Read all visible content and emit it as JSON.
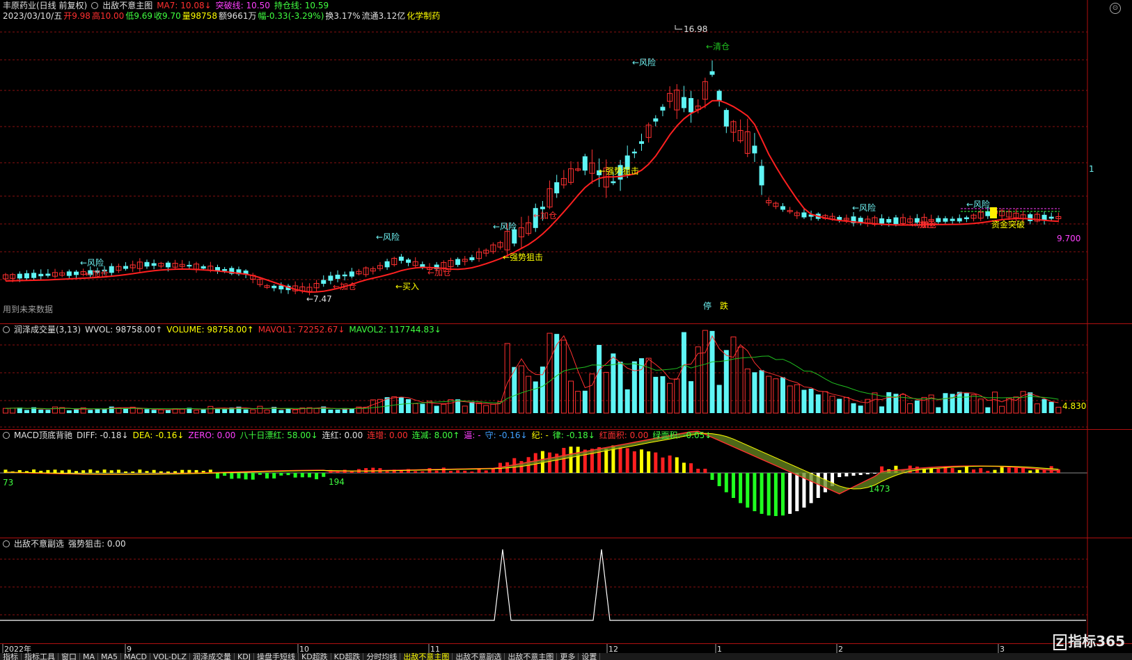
{
  "main": {
    "title_stock": "丰原药业(日线 前复权)",
    "title_indicator": "出敌不意主图",
    "ma7": "MA7: 10.08↓",
    "breakout": "突破线: 10.50",
    "hold": "持仓线: 10.59",
    "date": "2023/03/10/五",
    "open": "开9.98",
    "high": "高10.00",
    "low": "低9.69",
    "close": "收9.70",
    "vol": "量98758",
    "amount": "额9661万",
    "change": "幅-0.33(-3.29%)",
    "turnover": "换3.17%",
    "float": "流通3.12亿",
    "sector": "化学制药",
    "future_note": "用到未来数据",
    "max_label": "16.98",
    "min_label": "7.47",
    "last_label": "9.700",
    "stop_label": "停",
    "drop_label": "跌",
    "signals": [
      {
        "text": "←风险",
        "color": "#6ef0f0"
      },
      {
        "text": "←加仓",
        "color": "#ff3030"
      },
      {
        "text": "←加仓",
        "color": "#ff3030"
      },
      {
        "text": "←风险",
        "color": "#6ef0f0"
      },
      {
        "text": "←买入",
        "color": "#ffff00"
      },
      {
        "text": "←加仓",
        "color": "#ff3030"
      },
      {
        "text": "←风险",
        "color": "#6ef0f0"
      },
      {
        "text": "←强势狙击",
        "color": "#ffff00"
      },
      {
        "text": "←加仓",
        "color": "#ff3030"
      },
      {
        "text": "←强势狙击",
        "color": "#ffff00"
      },
      {
        "text": "←风险",
        "color": "#6ef0f0"
      },
      {
        "text": "←清仓",
        "color": "#20c020"
      },
      {
        "text": "←加仓",
        "color": "#ff3030"
      },
      {
        "text": "←风险",
        "color": "#6ef0f0"
      },
      {
        "text": "←加仓",
        "color": "#ff3030"
      },
      {
        "text": "←风险",
        "color": "#6ef0f0"
      },
      {
        "text": "资金突破",
        "color": "#ffff00"
      }
    ],
    "right_edge_label": "1"
  },
  "vol": {
    "title": "润泽成交量(3,13)",
    "wvol": "WVOL: 98758.00↑",
    "volume": "VOLUME: 98758.00↑",
    "mavol1": "MAVOL1: 72252.67↓",
    "mavol2": "MAVOL2: 117744.83↓",
    "right_label": "4.830"
  },
  "macd": {
    "title": "MACD顶底背驰",
    "diff": "DIFF: -0.18↓",
    "dea": "DEA: -0.16↓",
    "zero": "ZERO: 0.00",
    "eighty": "八十日漂红: 58.00↓",
    "lianhong": "连红: 0.00",
    "lianzeng": "连增: 0.00",
    "lianjian": "连减: 8.00↑",
    "jin": "逼: -",
    "shou": "守: -0.16↓",
    "ji": "纪: -",
    "lv": "律: -0.18↓",
    "hongmianji": "红面积: 0.00",
    "lvmianji": "绿面积: -0.05↓",
    "labels": [
      "73",
      "194",
      "1473"
    ]
  },
  "sub": {
    "title": "出敌不意副选",
    "value": "强势狙击: 0.00"
  },
  "axis": {
    "labels": [
      "2022年",
      "9",
      "10",
      "11",
      "12",
      "1",
      "2",
      "3"
    ]
  },
  "tabs": [
    "指标",
    "指标工具",
    "窗口",
    "MA",
    "MA5",
    "MACD",
    "VOL-DLZ",
    "润泽成交量",
    "KDJ",
    "操盘手短线",
    "KD超跌",
    "KD超跌",
    "分时均线",
    "出敌不意主图",
    "出敌不意副选",
    "出敌不意主图",
    "更多",
    "设置"
  ],
  "brand": {
    "box": "Z",
    "text": "指标365"
  }
}
